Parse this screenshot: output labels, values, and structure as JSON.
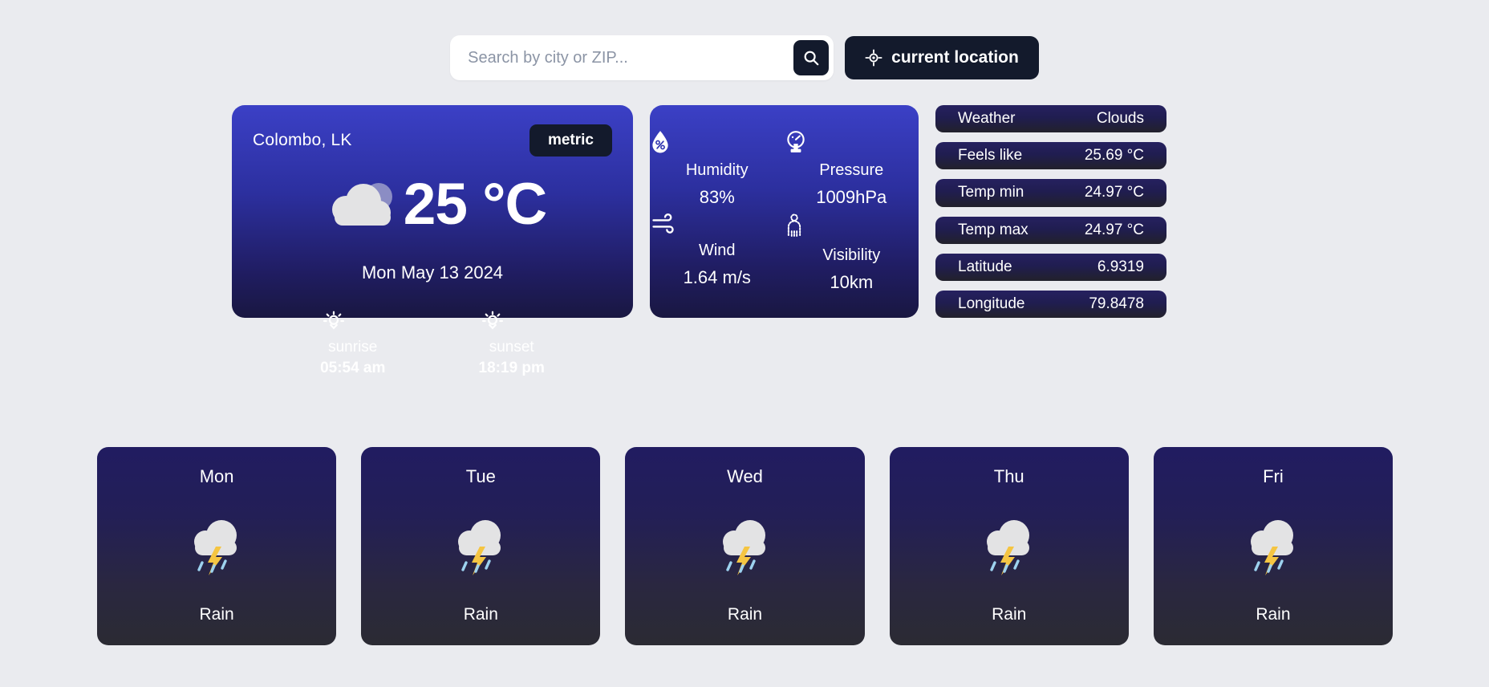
{
  "search": {
    "placeholder": "Search by city or ZIP...",
    "value": "",
    "search_icon": "search-icon",
    "current_location_label": "current location",
    "current_location_icon": "crosshair-location-icon"
  },
  "current": {
    "city": "Colombo, LK",
    "units_toggle_label": "metric",
    "weather_icon": "cloudy-icon",
    "temperature": "25 °C",
    "date": "Mon May 13 2024",
    "sunrise": {
      "icon": "sunrise-icon",
      "label": "sunrise",
      "time": "05:54 am"
    },
    "sunset": {
      "icon": "sunset-icon",
      "label": "sunset",
      "time": "18:19 pm"
    }
  },
  "details": [
    {
      "icon": "humidity-droplet-icon",
      "label": "Humidity",
      "value": "83%"
    },
    {
      "icon": "pressure-gauge-icon",
      "label": "Pressure",
      "value": "1009hPa"
    },
    {
      "icon": "wind-icon",
      "label": "Wind",
      "value": "1.64 m/s"
    },
    {
      "icon": "visibility-fog-icon",
      "label": "Visibility",
      "value": "10km"
    }
  ],
  "info_pills": [
    {
      "key": "Weather",
      "value": "Clouds"
    },
    {
      "key": "Feels like",
      "value": "25.69 °C"
    },
    {
      "key": "Temp min",
      "value": "24.97 °C"
    },
    {
      "key": "Temp max",
      "value": "24.97 °C"
    },
    {
      "key": "Latitude",
      "value": "6.9319"
    },
    {
      "key": "Longitude",
      "value": "79.8478"
    }
  ],
  "forecast": [
    {
      "day": "Mon",
      "icon": "thunderstorm-rain-icon",
      "desc": "Rain"
    },
    {
      "day": "Tue",
      "icon": "thunderstorm-rain-icon",
      "desc": "Rain"
    },
    {
      "day": "Wed",
      "icon": "thunderstorm-rain-icon",
      "desc": "Rain"
    },
    {
      "day": "Thu",
      "icon": "thunderstorm-rain-icon",
      "desc": "Rain"
    },
    {
      "day": "Fri",
      "icon": "thunderstorm-rain-icon",
      "desc": "Rain"
    }
  ],
  "colors": {
    "page_background": "#eaebef",
    "card_gradient_top": "#3b40c6",
    "card_gradient_bottom": "#191741",
    "dark_button": "#131a2c",
    "pill_gradient_top": "#262160",
    "pill_gradient_bottom": "#22212b",
    "forecast_gradient_top": "#211c61",
    "forecast_gradient_bottom": "#2b2b33",
    "lightning_yellow": "#f5c542",
    "cloud_white": "#e3e3e4",
    "rain_blue": "#9dd2ef"
  }
}
